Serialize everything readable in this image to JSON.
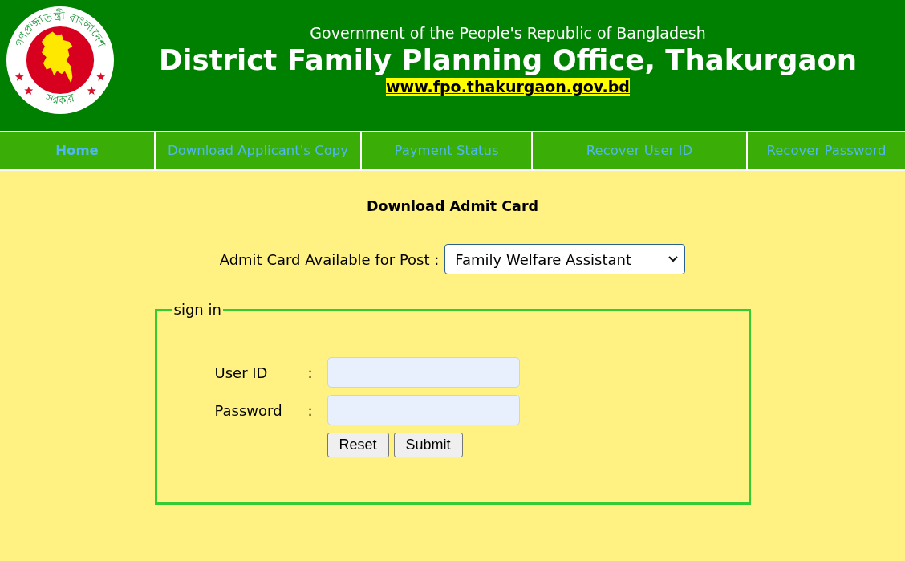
{
  "header": {
    "seal": {
      "top_text": "গণপ্রজাতন্ত্রী বাংলাদেশ",
      "bottom_text": "সরকার"
    },
    "subtitle": "Government of the People's Republic of Bangladesh",
    "title": "District Family Planning Office, Thakurgaon",
    "website": "www.fpo.thakurgaon.gov.bd"
  },
  "nav": [
    {
      "label": "Home",
      "selected": true
    },
    {
      "label": "Download Applicant's Copy",
      "selected": false
    },
    {
      "label": "Payment Status",
      "selected": false
    },
    {
      "label": "Recover User ID",
      "selected": false
    },
    {
      "label": "Recover Password",
      "selected": false
    }
  ],
  "page_title": "Download Admit Card",
  "post_selector": {
    "label": "Admit Card Available for Post :",
    "value": "Family Welfare Assistant"
  },
  "sign_in": {
    "legend": "sign in",
    "fields": [
      {
        "label": "User ID",
        "separator": ":"
      },
      {
        "label": "Password",
        "separator": ":"
      }
    ],
    "buttons": [
      "Reset",
      "Submit"
    ]
  }
}
